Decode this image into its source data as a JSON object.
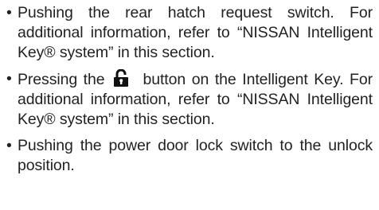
{
  "bullet_char": "•",
  "items": [
    {
      "text": "Pushing the rear hatch request switch. For additional information, refer to “NISSAN Intelligent Key® system” in this section."
    },
    {
      "text_before_icon": "Pressing the",
      "icon": "unlocked-padlock-icon",
      "text_after_icon": "button on the Intelligent Key. For additional information, refer to “NISSAN Intelligent Key® system” in this section."
    },
    {
      "text": "Pushing the power door lock switch to the unlock position."
    }
  ]
}
